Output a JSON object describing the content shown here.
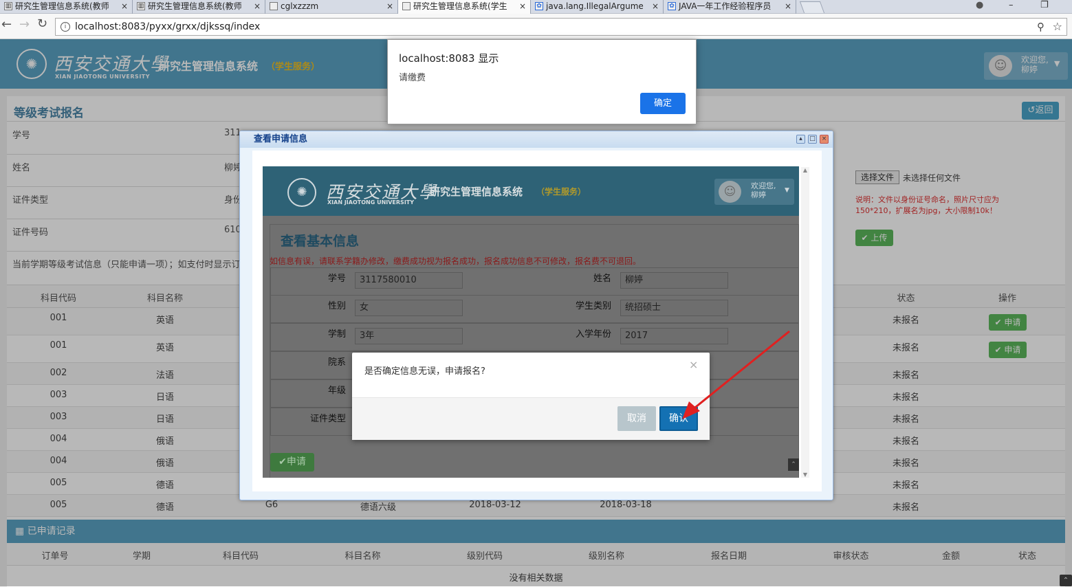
{
  "browser": {
    "tabs": [
      {
        "title": "研究生管理信息系统(教师"
      },
      {
        "title": "研究生管理信息系统(教师"
      },
      {
        "title": "cglxzzzm"
      },
      {
        "title": "研究生管理信息系统(学生"
      },
      {
        "title": "java.lang.IllegalArgume"
      },
      {
        "title": "JAVA一年工作经验程序员"
      }
    ],
    "url": "localhost:8083/pyxx/grxx/djkssq/index"
  },
  "app": {
    "logo_cn": "西安交通大學",
    "logo_en": "XIAN JIAOTONG UNIVERSITY",
    "system_title": "研究生管理信息系统",
    "system_sub": "（学生服务）",
    "welcome": "欢迎您,",
    "user_name": "柳婷"
  },
  "page": {
    "title": "等级考试报名",
    "back_label": "返回",
    "info_rows": [
      {
        "label": "学号",
        "value": "311"
      },
      {
        "label": "姓名",
        "value": "柳婷"
      },
      {
        "label": "证件类型",
        "value": "身份"
      },
      {
        "label": "证件号码",
        "value": "610"
      }
    ],
    "file_button": "选择文件",
    "file_status": "未选择任何文件",
    "upload_note": "说明：文件以身份证号命名，照片尺寸应为150*210，扩展名为jpg，大小限制10k！",
    "upload_label": "上传",
    "semester_note": "当前学期等级考试信息（只能申请一项）；如支付时显示订单",
    "exam_table": {
      "headers": [
        "科目代码",
        "科目名称",
        "状态",
        "操作"
      ],
      "rows": [
        {
          "code": "001",
          "name": "英语",
          "status": "未报名",
          "action": "申请"
        },
        {
          "code": "001",
          "name": "英语",
          "status": "未报名",
          "action": "申请"
        },
        {
          "code": "002",
          "name": "法语",
          "status": "未报名",
          "action": ""
        },
        {
          "code": "003",
          "name": "日语",
          "status": "未报名",
          "action": ""
        },
        {
          "code": "003",
          "name": "日语",
          "status": "未报名",
          "action": ""
        },
        {
          "code": "004",
          "name": "俄语",
          "status": "未报名",
          "action": ""
        },
        {
          "code": "004",
          "name": "俄语",
          "status": "未报名",
          "action": ""
        },
        {
          "code": "005",
          "name": "德语",
          "status": "未报名",
          "action": ""
        },
        {
          "code": "005",
          "name": "德语",
          "status": "未报名",
          "action": ""
        }
      ],
      "last_row_extra": {
        "level_code": "G6",
        "level_name": "德语六级",
        "start": "2018-03-12",
        "end": "2018-03-18"
      }
    },
    "applied": {
      "title": "已申请记录",
      "headers": [
        "订单号",
        "学期",
        "科目代码",
        "科目名称",
        "级别代码",
        "级别名称",
        "报名日期",
        "审核状态",
        "金额",
        "状态"
      ],
      "empty": "没有相关数据"
    }
  },
  "window_modal": {
    "title": "查看申请信息"
  },
  "inner": {
    "section_title": "查看基本信息",
    "warning": "如信息有误，请联系学籍办修改，缴费成功视为报名成功，报名成功信息不可修改，报名费不可退回。",
    "fields": [
      {
        "label": "学号",
        "value": "3117580010"
      },
      {
        "label": "姓名",
        "value": "柳婷"
      },
      {
        "label": "性别",
        "value": "女"
      },
      {
        "label": "学生类别",
        "value": "统招硕士"
      },
      {
        "label": "学制",
        "value": "3年"
      },
      {
        "label": "入学年份",
        "value": "2017"
      },
      {
        "label": "院系",
        "value": ""
      },
      {
        "label": "年级",
        "value": ""
      },
      {
        "label": "证件类型",
        "value": ""
      }
    ],
    "apply_label": "申请"
  },
  "confirm": {
    "message": "是否确定信息无误，申请报名?",
    "cancel": "取消",
    "ok": "确认"
  },
  "alert": {
    "origin": "localhost:8083 显示",
    "message": "请缴费",
    "ok": "确定"
  },
  "colors": {
    "header": "#5aa3c4",
    "green": "#5cb85c",
    "blue": "#1a73e8"
  }
}
